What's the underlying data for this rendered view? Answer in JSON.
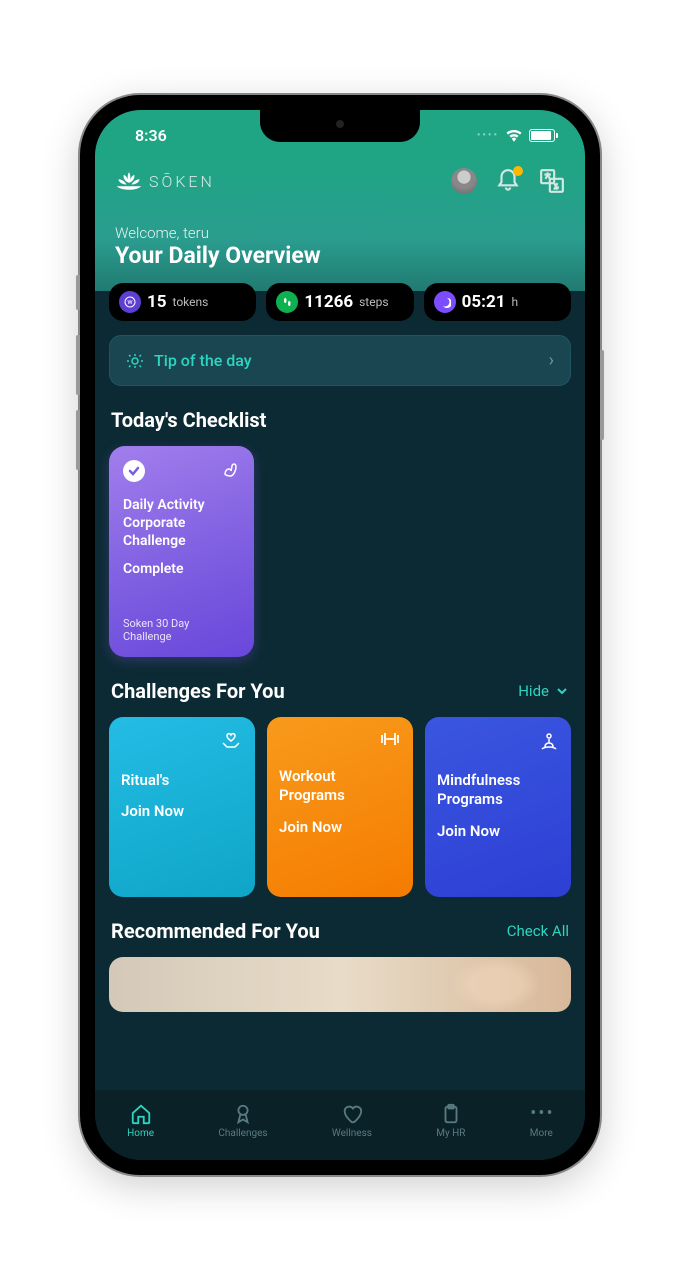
{
  "status": {
    "time": "8:36"
  },
  "header": {
    "brand": "SŌKEN",
    "welcome": "Welcome, teru",
    "overview": "Your Daily Overview"
  },
  "stats": {
    "tokens": {
      "value": "15",
      "unit": "tokens"
    },
    "steps": {
      "value": "11266",
      "unit": "steps"
    },
    "sleep": {
      "value": "05:21",
      "unit": "h"
    }
  },
  "tip": {
    "label": "Tip of the day"
  },
  "sections": {
    "checklist_title": "Today's Checklist",
    "challenges_title": "Challenges For You",
    "challenges_action": "Hide",
    "recommended_title": "Recommended For You",
    "recommended_action": "Check All"
  },
  "checklist_card": {
    "title": "Daily Activity Corporate Challenge",
    "status": "Complete",
    "subtitle": "Soken 30 Day Challenge"
  },
  "challenges": {
    "rituals": {
      "title": "Ritual's",
      "cta": "Join Now"
    },
    "workout": {
      "title": "Workout Programs",
      "cta": "Join Now"
    },
    "mindfulness": {
      "title": "Mindfulness Programs",
      "cta": "Join Now"
    }
  },
  "nav": {
    "home": "Home",
    "challenges": "Challenges",
    "wellness": "Wellness",
    "myhr": "My HR",
    "more": "More"
  }
}
